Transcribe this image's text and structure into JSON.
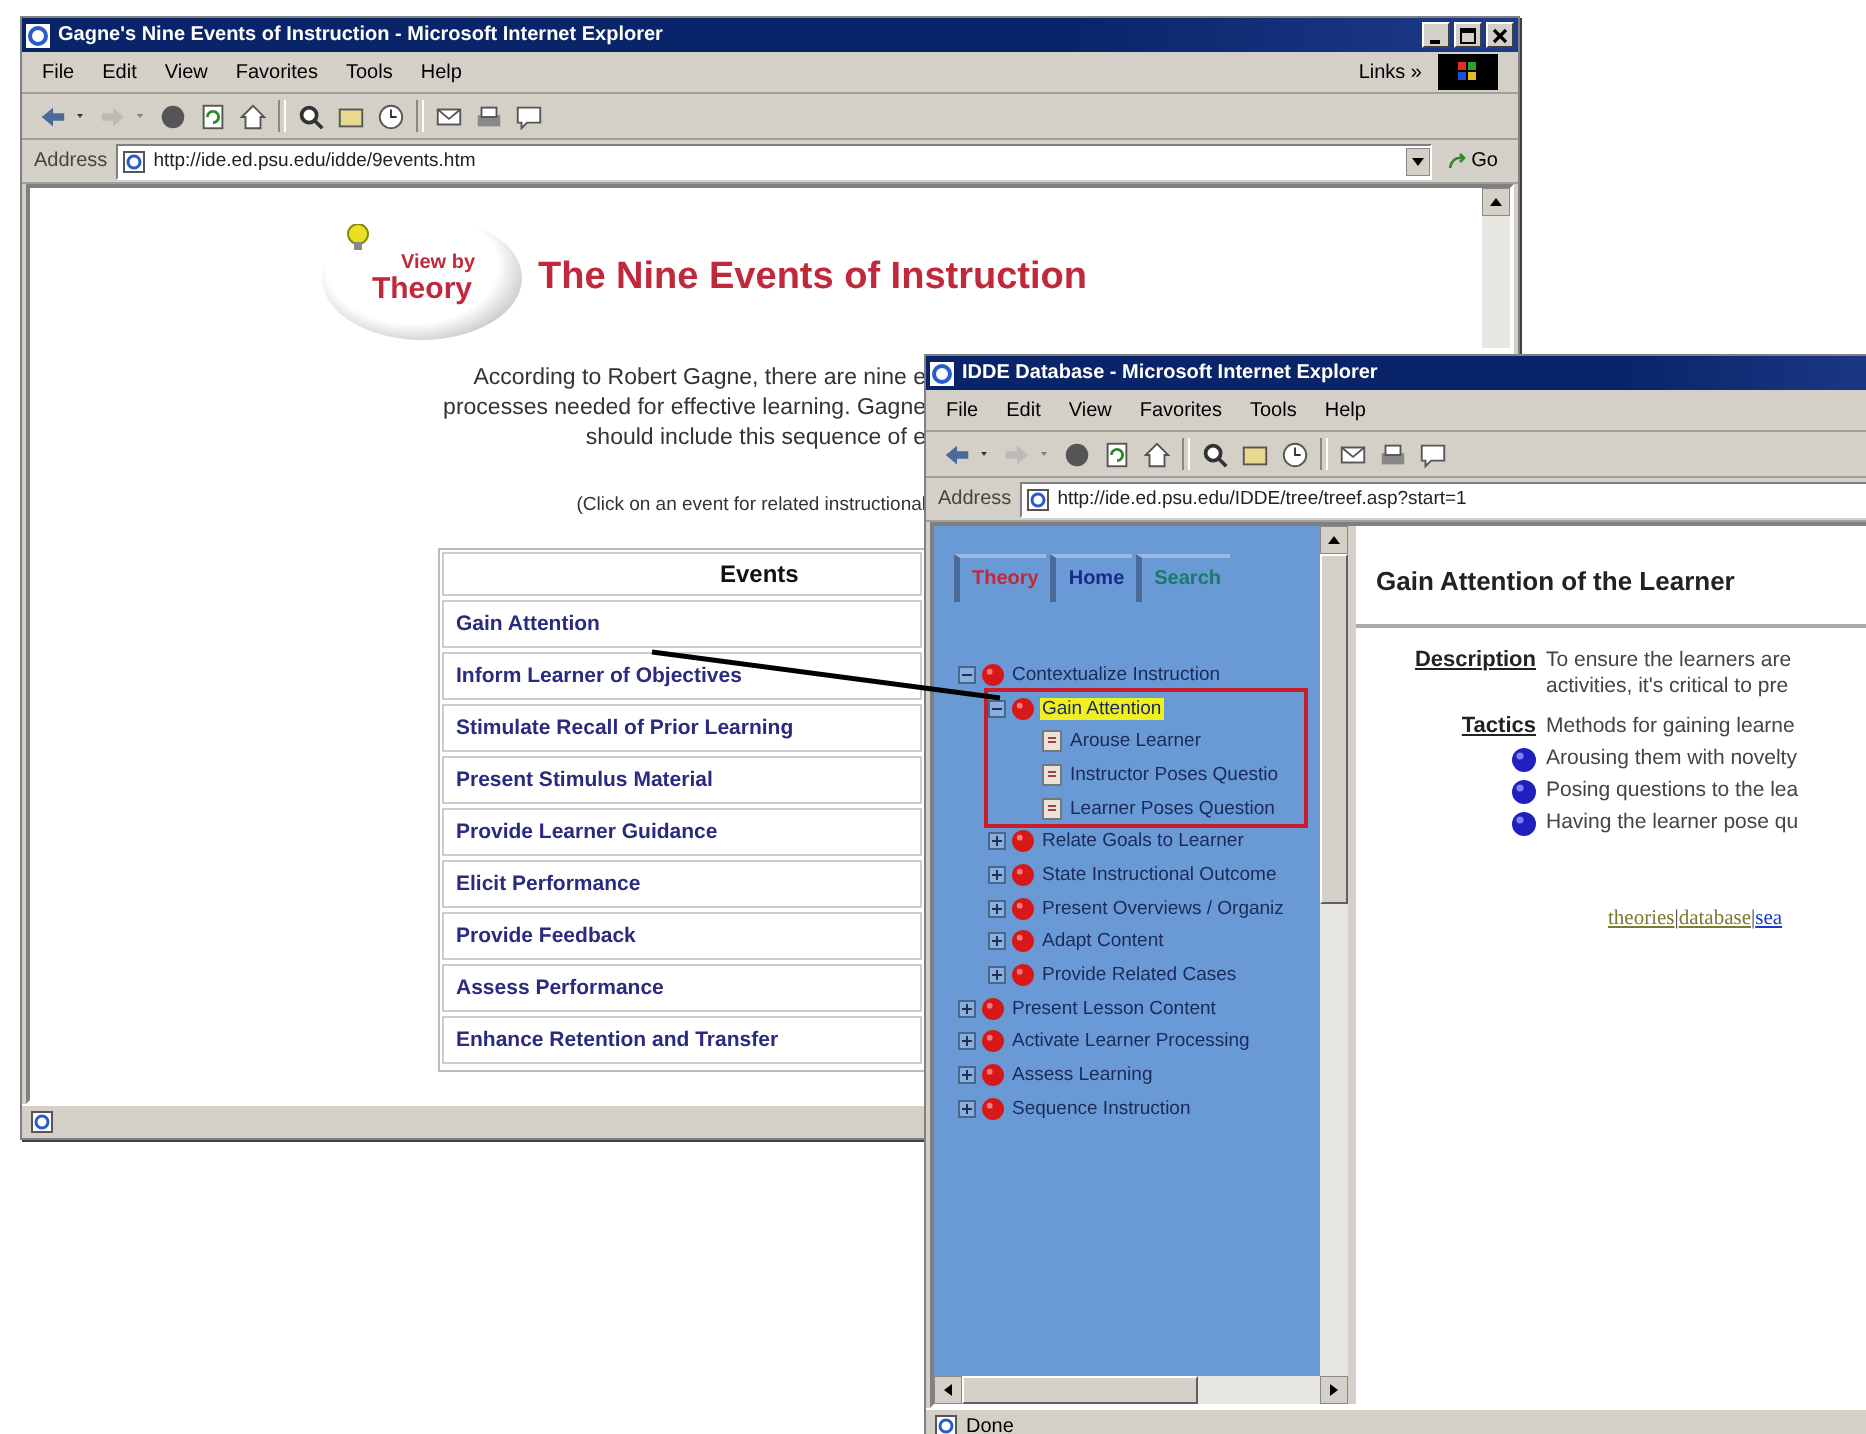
{
  "events_window": {
    "title": "Gagne's Nine Events of Instruction - Microsoft Internet Explorer",
    "menu": [
      "File",
      "Edit",
      "View",
      "Favorites",
      "Tools",
      "Help"
    ],
    "links_label": "Links »",
    "address_label": "Address",
    "address": "http://ide.ed.psu.edu/idde/9events.htm",
    "go_label": "Go",
    "logo": {
      "line1": "View by",
      "line2": "Theory"
    },
    "heading": "The Nine Events of Instruction",
    "intro_lines": [
      "According to Robert Gagne, there are nine e",
      "processes needed for effective learning. Gagne",
      "should include this sequence of e"
    ],
    "note": "(Click on an event for related instructional",
    "table": {
      "column": "Events",
      "rows": [
        {
          "text": "Gain Attention"
        },
        {
          "text": "Inform Learner of Objectives"
        },
        {
          "text": "Stimulate Recall of Prior Learning"
        },
        {
          "text": "Present Stimulus Material"
        },
        {
          "text": "Provide Learner Guidance"
        },
        {
          "text": "Elicit Performance"
        },
        {
          "text": "Provide Feedback"
        },
        {
          "text": "Assess Performance"
        },
        {
          "text": "Enhance Retention and Transfer"
        }
      ]
    }
  },
  "database_window": {
    "title": "IDDE Database - Microsoft Internet Explorer",
    "menu": [
      "File",
      "Edit",
      "View",
      "Favorites",
      "Tools",
      "Help"
    ],
    "address_label": "Address",
    "address": "http://ide.ed.psu.edu/IDDE/tree/treef.asp?start=1",
    "tabs": [
      {
        "label": "Theory",
        "color": "#c0283c"
      },
      {
        "label": "Home",
        "color": "#1a2a8a"
      },
      {
        "label": "Search",
        "color": "#1a7a6a"
      }
    ],
    "tree": [
      {
        "kind": "group",
        "label": "Contextualize Instruction",
        "expanded": true,
        "selected": false,
        "children": [
          {
            "kind": "group",
            "label": "Gain Attention",
            "expanded": true,
            "selected": true,
            "highlighted": true,
            "children": [
              {
                "kind": "page",
                "label": "Arouse Learner",
                "selected": false
              },
              {
                "kind": "page",
                "label": "Instructor Poses Questio",
                "selected": false
              },
              {
                "kind": "page",
                "label": "Learner Poses Question",
                "selected": false
              }
            ]
          },
          {
            "kind": "group",
            "label": "Relate Goals to Learner",
            "expanded": false,
            "selected": false
          },
          {
            "kind": "group",
            "label": "State Instructional Outcome",
            "expanded": false,
            "selected": false
          },
          {
            "kind": "group",
            "label": "Present Overviews / Organiz",
            "expanded": false,
            "selected": false
          },
          {
            "kind": "group",
            "label": "Adapt Content",
            "expanded": false,
            "selected": false
          },
          {
            "kind": "group",
            "label": "Provide Related Cases",
            "expanded": false,
            "selected": false
          }
        ]
      },
      {
        "kind": "group",
        "label": "Present Lesson Content",
        "expanded": false,
        "selected": false
      },
      {
        "kind": "group",
        "label": "Activate Learner Processing",
        "expanded": false,
        "selected": false
      },
      {
        "kind": "group",
        "label": "Assess Learning",
        "expanded": false,
        "selected": false
      },
      {
        "kind": "group",
        "label": "Sequence Instruction",
        "expanded": false,
        "selected": false
      }
    ],
    "detail": {
      "heading": "Gain Attention of the Learner",
      "description_label": "Description",
      "description_lines": [
        "To ensure the learners are",
        "activities, it's critical to pre"
      ],
      "tactics_label": "Tactics",
      "tactics_text": "Methods for gaining learne",
      "bullets": [
        "Arousing them with novelty",
        "Posing questions to the lea",
        "Having the learner pose qu"
      ],
      "footer_separator": "|",
      "footer_links": [
        {
          "text": "theories",
          "visited": true
        },
        {
          "text": "database",
          "visited": true
        },
        {
          "text": "sea",
          "visited": false
        }
      ]
    },
    "status": "Done"
  }
}
